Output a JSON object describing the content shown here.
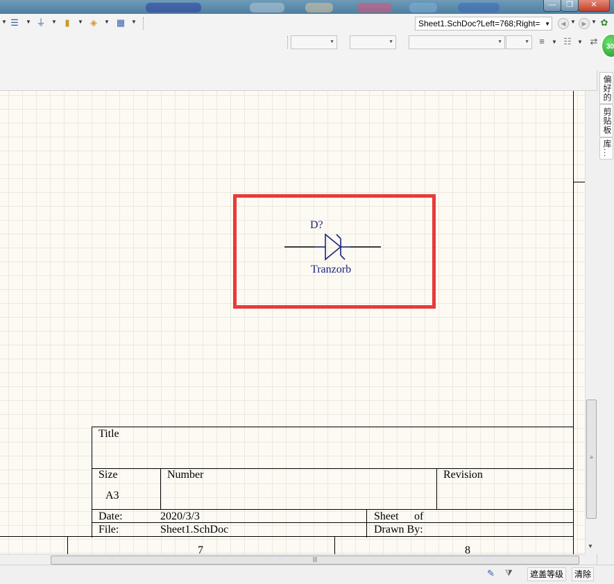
{
  "window": {
    "minimize": "—",
    "restore": "❐",
    "close": "✕"
  },
  "address": {
    "value": "Sheet1.SchDoc?Left=768;Right=",
    "badge": "30"
  },
  "side_tabs": [
    {
      "label": "偏好的"
    },
    {
      "label": "剪贴板"
    },
    {
      "label": "库..."
    }
  ],
  "component": {
    "designator": "D?",
    "name": "Tranzorb"
  },
  "title_block": {
    "title_label": "Title",
    "size_label": "Size",
    "size_value": "A3",
    "number_label": "Number",
    "revision_label": "Revision",
    "date_label": "Date:",
    "date_value": "2020/3/3",
    "sheet_label": "Sheet",
    "of_label": "of",
    "file_label": "File:",
    "file_value": "Sheet1.SchDoc",
    "drawn_by_label": "Drawn By:"
  },
  "zones": {
    "seven": "7",
    "eight": "8"
  },
  "status": {
    "mask_level": "遮盖等级",
    "clear": "清除"
  },
  "colors": {
    "selection": "#e83a3a",
    "component": "#1a237e",
    "canvas": "#fdfaf3"
  }
}
